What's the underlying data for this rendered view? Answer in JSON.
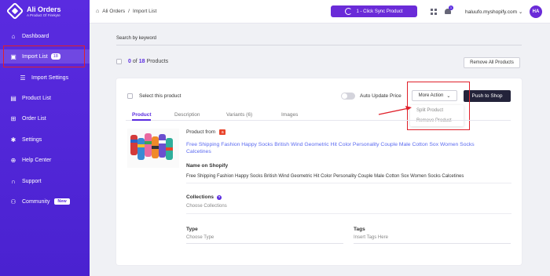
{
  "brand": {
    "title": "Ali Orders",
    "subtitle": "A Product Of Firekyte"
  },
  "sidebar": {
    "items": [
      {
        "label": "Dashboard",
        "icon": "home-icon"
      },
      {
        "label": "Import List",
        "icon": "inbox-icon",
        "badge": "18",
        "active": true
      },
      {
        "label": "Import Settings",
        "icon": "sliders-icon"
      },
      {
        "label": "Product List",
        "icon": "bag-icon"
      },
      {
        "label": "Order List",
        "icon": "cart-icon"
      },
      {
        "label": "Settings",
        "icon": "gear-icon"
      },
      {
        "label": "Help Center",
        "icon": "help-icon"
      },
      {
        "label": "Support",
        "icon": "headset-icon"
      },
      {
        "label": "Community",
        "icon": "users-icon",
        "badge": "New"
      }
    ]
  },
  "header": {
    "breadcrumb": [
      "Ali Orders",
      "Import List"
    ],
    "breadcrumb_sep": "/",
    "sync_label": "1 - Click Sync Product",
    "notification_count": "1",
    "shop": "haluufo.myshopify.com",
    "avatar": "HA"
  },
  "toolbar": {
    "search_label": "Search by keyword",
    "count_selected": "0",
    "count_of": "of",
    "count_total": "18",
    "count_suffix": "Products",
    "remove_all": "Remove All Products"
  },
  "card": {
    "select_label": "Select this product",
    "auto_update_label": "Auto Update Price",
    "more_action": "More Action",
    "push_label": "Push to Shop",
    "dropdown": [
      "Split Product",
      "Remove Product"
    ],
    "tabs": [
      "Product",
      "Description",
      "Variants (6)",
      "Images"
    ],
    "product_from_label": "Product from",
    "product_title": "Free Shipping Fashion Happy Socks British Wind Geometric Hit Color Personality Couple Male Cotton Sox Women Socks Calcetines",
    "name_on_shopify_label": "Name on Shopify",
    "name_on_shopify": "Free Shipping Fashion Happy Socks British Wind Geometric Hit Color Personality Couple Male Cotton Sox Women Socks Calcetines",
    "collections_label": "Collections",
    "collections_placeholder": "Choose Collections",
    "type_label": "Type",
    "type_placeholder": "Choose Type",
    "tags_label": "Tags",
    "tags_placeholder": "Insert Tags Here"
  },
  "colors": {
    "brand": "#5a2be0",
    "highlight": "#e0202a",
    "push_button": "#23233a",
    "link": "#5b6af0"
  }
}
